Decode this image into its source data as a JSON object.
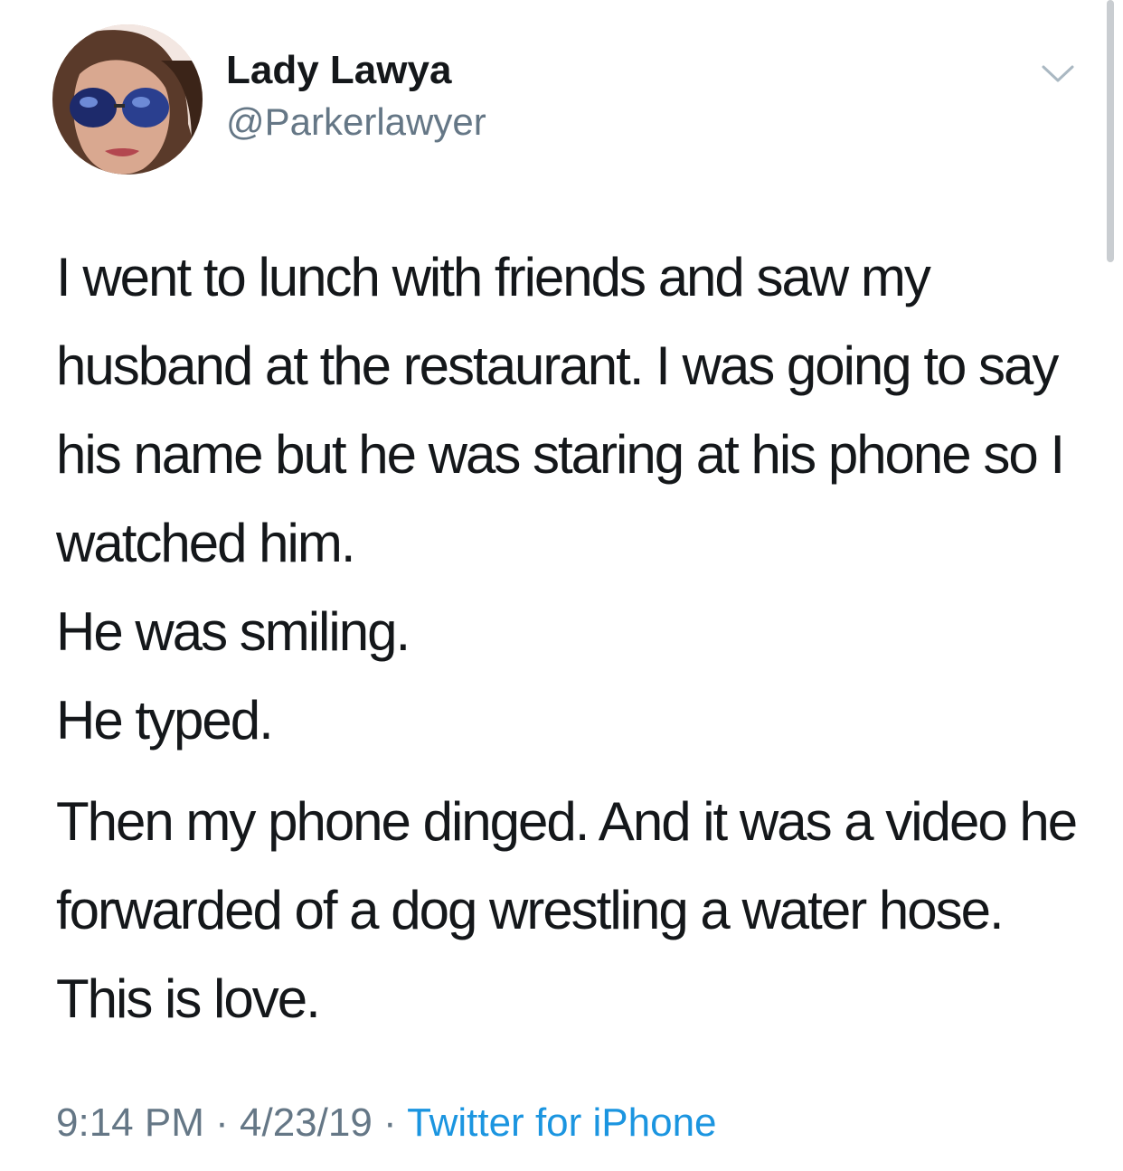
{
  "author": {
    "display_name": "Lady Lawya",
    "handle": "@Parkerlawyer"
  },
  "tweet": {
    "paragraphs": [
      "I went to lunch with friends and saw my husband at the restaurant. I was going to say his name but he was staring at his phone so I watched him.",
      "He was smiling.",
      "He typed.",
      "Then my phone dinged. And it was a video he forwarded of a dog wrestling a water hose. This is love."
    ]
  },
  "meta": {
    "time": "9:14 PM",
    "separator_1": "·",
    "date": "4/23/19",
    "separator_2": "·",
    "source": "Twitter for iPhone"
  },
  "icons": {
    "menu": "chevron-down-icon"
  },
  "colors": {
    "text": "#14171a",
    "secondary": "#657786",
    "link": "#1b95e0"
  }
}
